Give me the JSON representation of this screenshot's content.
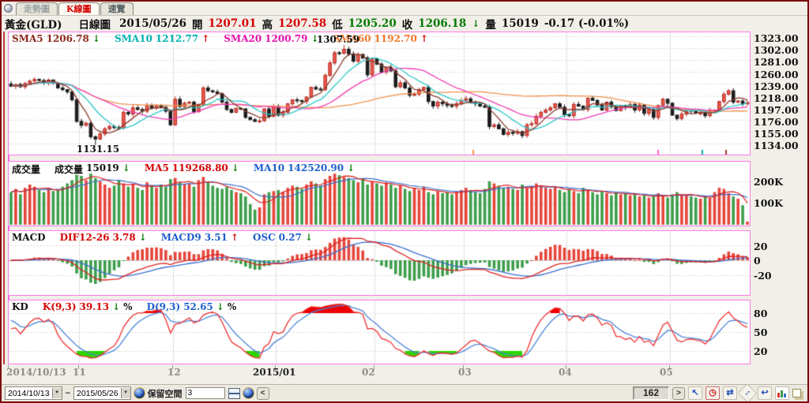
{
  "tabs": [
    {
      "label": "走勢圖",
      "active": false
    },
    {
      "label": "K線圖",
      "active": true
    },
    {
      "label": "速覽",
      "active": false
    }
  ],
  "info_bar": {
    "symbol": "黃金(GLD)",
    "chart_type": "日線圖",
    "date": "2015/05/26",
    "open_label": "開",
    "open": "1207.01",
    "high_label": "高",
    "high": "1207.58",
    "low_label": "低",
    "low": "1205.20",
    "close_label": "收",
    "close": "1206.18",
    "close_arrow": "↓",
    "volume_label": "量",
    "volume": "15019",
    "change": "-0.17 (-0.01%)"
  },
  "price_panel": {
    "legend": [
      {
        "label": "SMA5",
        "value": "1206.78",
        "arrow": "↓"
      },
      {
        "label": "SMA10",
        "value": "1212.77",
        "arrow": "↑"
      },
      {
        "label": "SMA20",
        "value": "1200.79",
        "arrow": "↓"
      },
      {
        "label": "SMA60",
        "value": "1192.70",
        "arrow": "↑"
      }
    ],
    "y_ticks": [
      "1323.00",
      "1302.00",
      "1281.00",
      "1260.00",
      "1239.00",
      "1218.00",
      "1197.00",
      "1176.00",
      "1155.00",
      "1134.00"
    ],
    "annotations": {
      "peak": "1307.59",
      "trough": "1131.15"
    }
  },
  "volume_panel": {
    "title": "成交量",
    "legend": [
      {
        "label": "成交量",
        "value": "15019",
        "arrow": "↓"
      },
      {
        "label": "MA5",
        "value": "119268.80",
        "arrow": "↓"
      },
      {
        "label": "MA10",
        "value": "142520.90",
        "arrow": "↓"
      }
    ],
    "y_ticks": [
      "200K",
      "100K"
    ]
  },
  "macd_panel": {
    "title": "MACD",
    "legend": [
      {
        "label": "DIF12-26",
        "value": "3.78",
        "arrow": "↓"
      },
      {
        "label": "MACD9",
        "value": "3.51",
        "arrow": "↑"
      },
      {
        "label": "OSC",
        "value": "0.27",
        "arrow": "↓"
      }
    ],
    "y_ticks": [
      "20",
      "0",
      "-20"
    ]
  },
  "kd_panel": {
    "title": "KD",
    "legend": [
      {
        "label": "K(9,3)",
        "value": "39.13",
        "arrow": "↓",
        "suffix": "%"
      },
      {
        "label": "D(9,3)",
        "value": "52.65",
        "arrow": "↓",
        "suffix": "%"
      }
    ],
    "y_ticks": [
      "80",
      "50",
      "20"
    ]
  },
  "x_axis": {
    "labels": [
      "2014/10/13",
      "11",
      "12",
      "2015/01",
      "02",
      "03",
      "04",
      "05"
    ]
  },
  "status_bar": {
    "date_from": "2014/10/13",
    "tilde": "~",
    "date_to": "2015/05/26",
    "reserve_label": "保留空間",
    "reserve_value": "3",
    "bar_count": "162",
    "left_arrow": "<",
    "right_arrow": ">",
    "icons": {
      "pointer": "↖",
      "clock": "◷",
      "swap": "⇄",
      "resize": "↕",
      "undo": "↩",
      "dropdown": "▼"
    }
  },
  "colors": {
    "up_candle": "#f05a50",
    "up_stroke": "#b22a20",
    "down_candle": "#1b1b1b",
    "vol_up": "#e5463c",
    "vol_down": "#3d9e4b",
    "sma5": "#8b3a2e",
    "sma10": "#2cc8c8",
    "sma20": "#f03cb4",
    "sma60": "#f0924e",
    "ma5_vol": "#dd2222",
    "ma10_vol": "#3a6fd0",
    "dif": "#dd2222",
    "dea": "#3a6fd0",
    "hist_up": "#e5463c",
    "hist_down": "#3d9e4b",
    "k_line": "#ee3030",
    "d_line": "#4a86d8",
    "kd_fill_high": "#ee0000",
    "kd_fill_low": "#2ed400",
    "grid": "#d9d9d9",
    "vgrid": "#e0dede",
    "panel_border": "#ff7ce8"
  },
  "chart_data": {
    "type": "candlestick+volume+macd+kd",
    "title": "黃金(GLD) 日線圖",
    "x_range": [
      "2014/10/13",
      "2015/05/26"
    ],
    "price_axis": {
      "top": 1323,
      "step": 21,
      "ticks": 10
    },
    "closes": [
      1235,
      1238,
      1234,
      1240,
      1244,
      1247,
      1245,
      1241,
      1246,
      1240,
      1232,
      1229,
      1225,
      1211,
      1173,
      1166,
      1170,
      1146,
      1142,
      1151,
      1160,
      1164,
      1162,
      1161,
      1189,
      1186,
      1197,
      1194,
      1191,
      1201,
      1197,
      1201,
      1198,
      1191,
      1167,
      1212,
      1199,
      1205,
      1207,
      1190,
      1203,
      1232,
      1227,
      1225,
      1222,
      1207,
      1194,
      1189,
      1196,
      1195,
      1180,
      1176,
      1173,
      1174,
      1195,
      1182,
      1200,
      1184,
      1189,
      1204,
      1211,
      1210,
      1208,
      1216,
      1233,
      1230,
      1229,
      1254,
      1276,
      1294,
      1293,
      1300,
      1292,
      1279,
      1291,
      1285,
      1255,
      1283,
      1274,
      1260,
      1268,
      1262,
      1234,
      1241,
      1232,
      1219,
      1221,
      1229,
      1233,
      1208,
      1200,
      1207,
      1204,
      1201,
      1200,
      1204,
      1210,
      1213,
      1206,
      1204,
      1200,
      1198,
      1164,
      1167,
      1160,
      1150,
      1154,
      1152,
      1155,
      1148,
      1167,
      1169,
      1182,
      1189,
      1193,
      1197,
      1204,
      1198,
      1185,
      1183,
      1203,
      1200,
      1194,
      1214,
      1210,
      1202,
      1193,
      1207,
      1199,
      1192,
      1201,
      1198,
      1203,
      1193,
      1202,
      1187,
      1194,
      1180,
      1201,
      1212,
      1205,
      1184,
      1178,
      1186,
      1193,
      1191,
      1188,
      1188,
      1183,
      1192,
      1193,
      1208,
      1221,
      1227,
      1207,
      1209,
      1204,
      1206.18
    ],
    "volumes_k": [
      150,
      165,
      140,
      170,
      185,
      175,
      160,
      150,
      170,
      155,
      160,
      175,
      190,
      205,
      230,
      225,
      205,
      235,
      215,
      200,
      185,
      170,
      180,
      205,
      190,
      175,
      185,
      170,
      160,
      195,
      180,
      170,
      185,
      175,
      210,
      215,
      195,
      185,
      190,
      175,
      205,
      220,
      195,
      180,
      170,
      165,
      175,
      160,
      150,
      145,
      130,
      95,
      70,
      80,
      140,
      150,
      155,
      160,
      150,
      170,
      180,
      175,
      165,
      185,
      200,
      190,
      180,
      210,
      225,
      235,
      228,
      220,
      215,
      205,
      195,
      210,
      185,
      200,
      190,
      180,
      195,
      185,
      170,
      180,
      165,
      155,
      170,
      160,
      175,
      150,
      140,
      155,
      145,
      150,
      140,
      150,
      160,
      170,
      160,
      150,
      145,
      165,
      200,
      190,
      180,
      170,
      175,
      165,
      160,
      185,
      170,
      175,
      190,
      180,
      170,
      165,
      175,
      160,
      150,
      165,
      155,
      145,
      170,
      160,
      150,
      140,
      155,
      145,
      135,
      150,
      140,
      145,
      135,
      140,
      130,
      135,
      125,
      130,
      145,
      135,
      125,
      140,
      150,
      140,
      135,
      130,
      125,
      120,
      130,
      125,
      150,
      170,
      165,
      145,
      130,
      120,
      90,
      15
    ],
    "forced": [
      {
        "type": "high",
        "index": 71,
        "value": 1307.59
      },
      {
        "type": "low",
        "index": 18,
        "value": 1131.15
      }
    ],
    "month_start_indices": [
      15,
      35,
      57,
      78,
      97,
      119,
      141
    ],
    "event_ticks": [
      {
        "x": 598,
        "color": "#f0924e"
      },
      {
        "x": 832,
        "color": "#ff66cc"
      },
      {
        "x": 888,
        "color": "#00b2b2"
      },
      {
        "x": 918,
        "color": "#aa3333"
      }
    ]
  }
}
